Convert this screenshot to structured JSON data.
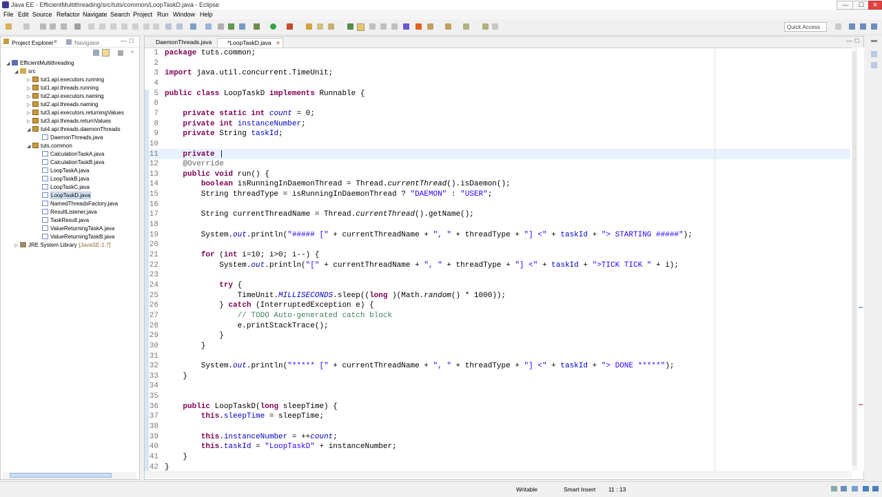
{
  "window": {
    "title": "Java EE - EfficientMultithreading/src/tuts/common/LoopTaskD.java - Eclipse",
    "controls": {
      "minimize": "—",
      "maximize": "☐",
      "close": "✕"
    }
  },
  "menu": [
    "File",
    "Edit",
    "Source",
    "Refactor",
    "Navigate",
    "Search",
    "Project",
    "Run",
    "Window",
    "Help"
  ],
  "toolbar": {
    "quick_access": "Quick Access"
  },
  "left_panel": {
    "tabs": [
      "Project Explorer",
      "Navigator"
    ],
    "tree": [
      {
        "label": "EfficientMultithreading",
        "level": 0,
        "icon": "project",
        "expanded": true
      },
      {
        "label": "src",
        "level": 1,
        "icon": "source-folder",
        "expanded": true
      },
      {
        "label": "tut1.api.executors.running",
        "level": 2,
        "icon": "package"
      },
      {
        "label": "tut1.api.threads.running",
        "level": 2,
        "icon": "package"
      },
      {
        "label": "tut2.api.executors.naming",
        "level": 2,
        "icon": "package"
      },
      {
        "label": "tut2.api.threads.naming",
        "level": 2,
        "icon": "package"
      },
      {
        "label": "tut3.api.executors.returningValues",
        "level": 2,
        "icon": "package"
      },
      {
        "label": "tut3.api.threads.returnValues",
        "level": 2,
        "icon": "package"
      },
      {
        "label": "tut4.api.threads.daemonThreads",
        "level": 2,
        "icon": "package",
        "expanded": true
      },
      {
        "label": "DaemonThreads.java",
        "level": 3,
        "icon": "java-file"
      },
      {
        "label": "tuts.common",
        "level": 2,
        "icon": "package",
        "expanded": true
      },
      {
        "label": "CalculationTaskA.java",
        "level": 3,
        "icon": "java-file"
      },
      {
        "label": "CalculationTaskB.java",
        "level": 3,
        "icon": "java-file"
      },
      {
        "label": "LoopTaskA.java",
        "level": 3,
        "icon": "java-file"
      },
      {
        "label": "LoopTaskB.java",
        "level": 3,
        "icon": "java-file"
      },
      {
        "label": "LoopTaskC.java",
        "level": 3,
        "icon": "java-file"
      },
      {
        "label": "LoopTaskD.java",
        "level": 3,
        "icon": "java-file",
        "selected": true
      },
      {
        "label": "NamedThreadsFactory.java",
        "level": 3,
        "icon": "java-file"
      },
      {
        "label": "ResultListener.java",
        "level": 3,
        "icon": "java-file"
      },
      {
        "label": "TaskResult.java",
        "level": 3,
        "icon": "java-file"
      },
      {
        "label": "ValueReturningTaskA.java",
        "level": 3,
        "icon": "java-file"
      },
      {
        "label": "ValueReturningTaskB.java",
        "level": 3,
        "icon": "java-file"
      },
      {
        "label": "JRE System Library",
        "suffix": "[JavaSE-1.7]",
        "level": 1,
        "icon": "library"
      }
    ]
  },
  "editor": {
    "tabs": [
      {
        "label": "DaemonThreads.java",
        "active": false
      },
      {
        "label": "*LoopTaskD.java",
        "active": true
      }
    ],
    "cursor_line": 11,
    "lines": [
      {
        "n": "1",
        "tokens": [
          [
            "kw",
            "package"
          ],
          [
            "",
            "tuts.common;"
          ]
        ]
      },
      {
        "n": "2",
        "tokens": []
      },
      {
        "n": "3",
        "tokens": [
          [
            "kw",
            "import"
          ],
          [
            "",
            "java.util.concurrent.TimeUnit;"
          ]
        ]
      },
      {
        "n": "4",
        "tokens": []
      },
      {
        "n": "5",
        "tokens": [
          [
            "kw",
            "public class"
          ],
          [
            "",
            " LoopTaskD "
          ],
          [
            "kw",
            "implements"
          ],
          [
            "",
            " Runnable {"
          ]
        ]
      },
      {
        "n": "6",
        "tokens": []
      },
      {
        "n": "7",
        "tokens": [
          [
            "",
            "    "
          ],
          [
            "kw",
            "private static int"
          ],
          [
            "",
            " "
          ],
          [
            "sfld",
            "count"
          ],
          [
            "",
            " = 0;"
          ]
        ]
      },
      {
        "n": "8",
        "tokens": [
          [
            "",
            "    "
          ],
          [
            "kw",
            "private int"
          ],
          [
            "",
            " "
          ],
          [
            "fld",
            "instanceNumber"
          ],
          [
            "",
            ";"
          ]
        ]
      },
      {
        "n": "9",
        "tokens": [
          [
            "",
            "    "
          ],
          [
            "kw",
            "private"
          ],
          [
            "",
            " String "
          ],
          [
            "fld",
            "taskId"
          ],
          [
            "",
            ";"
          ]
        ]
      },
      {
        "n": "10",
        "tokens": []
      },
      {
        "n": "11",
        "tokens": [
          [
            "",
            "    "
          ],
          [
            "kw",
            "private"
          ],
          [
            "",
            " |"
          ]
        ]
      },
      {
        "n": "12",
        "tokens": [
          [
            "",
            "    "
          ],
          [
            "ann",
            "@Override"
          ]
        ]
      },
      {
        "n": "13",
        "tokens": [
          [
            "",
            "    "
          ],
          [
            "kw",
            "public void"
          ],
          [
            "",
            " run() {"
          ]
        ]
      },
      {
        "n": "14",
        "tokens": [
          [
            "",
            "        "
          ],
          [
            "kw",
            "boolean"
          ],
          [
            "",
            " isRunningInDaemonThread = Thread."
          ],
          [
            "ital",
            "currentThread"
          ],
          [
            "",
            "().isDaemon();"
          ]
        ]
      },
      {
        "n": "15",
        "tokens": [
          [
            "",
            "        String threadType = isRunningInDaemonThread ? "
          ],
          [
            "str",
            "\"DAEMON\""
          ],
          [
            "",
            " : "
          ],
          [
            "str",
            "\"USER\""
          ],
          [
            "",
            ";"
          ]
        ]
      },
      {
        "n": "16",
        "tokens": []
      },
      {
        "n": "17",
        "tokens": [
          [
            "",
            "        String currentThreadName = Thread."
          ],
          [
            "ital",
            "currentThread"
          ],
          [
            "",
            "().getName();"
          ]
        ]
      },
      {
        "n": "18",
        "tokens": []
      },
      {
        "n": "19",
        "tokens": [
          [
            "",
            "        System."
          ],
          [
            "sfld",
            "out"
          ],
          [
            "",
            ".println("
          ],
          [
            "str",
            "\"##### [\""
          ],
          [
            "",
            " + currentThreadName + "
          ],
          [
            "str",
            "\", \""
          ],
          [
            "",
            " + threadType + "
          ],
          [
            "str",
            "\"] <\""
          ],
          [
            "",
            " + "
          ],
          [
            "fld",
            "taskId"
          ],
          [
            "",
            " + "
          ],
          [
            "str",
            "\"> STARTING #####\""
          ],
          [
            "",
            ");"
          ]
        ]
      },
      {
        "n": "20",
        "tokens": []
      },
      {
        "n": "21",
        "tokens": [
          [
            "",
            "        "
          ],
          [
            "kw",
            "for"
          ],
          [
            "",
            " ("
          ],
          [
            "kw",
            "int"
          ],
          [
            "",
            " i=10; i>0; i--) {"
          ]
        ]
      },
      {
        "n": "22",
        "tokens": [
          [
            "",
            "            System."
          ],
          [
            "sfld",
            "out"
          ],
          [
            "",
            ".println("
          ],
          [
            "str",
            "\"[\""
          ],
          [
            "",
            " + currentThreadName + "
          ],
          [
            "str",
            "\", \""
          ],
          [
            "",
            " + threadType + "
          ],
          [
            "str",
            "\"] <\""
          ],
          [
            "",
            " + "
          ],
          [
            "fld",
            "taskId"
          ],
          [
            "",
            " + "
          ],
          [
            "str",
            "\">TICK TICK \""
          ],
          [
            "",
            " + i);"
          ]
        ]
      },
      {
        "n": "23",
        "tokens": []
      },
      {
        "n": "24",
        "tokens": [
          [
            "",
            "            "
          ],
          [
            "kw",
            "try"
          ],
          [
            "",
            " {"
          ]
        ]
      },
      {
        "n": "25",
        "tokens": [
          [
            "",
            "                TimeUnit."
          ],
          [
            "sfld",
            "MILLISECONDS"
          ],
          [
            "",
            ".sleep(("
          ],
          [
            "kw",
            "long"
          ],
          [
            "",
            ")(Math."
          ],
          [
            "ital",
            "random"
          ],
          [
            "",
            "() * 1000));"
          ]
        ]
      },
      {
        "n": "26",
        "tokens": [
          [
            "",
            "            } "
          ],
          [
            "kw",
            "catch"
          ],
          [
            "",
            " (InterruptedException e) {"
          ]
        ]
      },
      {
        "n": "27",
        "tokens": [
          [
            "",
            "                "
          ],
          [
            "cmt",
            "// TODO Auto-generated catch block"
          ]
        ]
      },
      {
        "n": "28",
        "tokens": [
          [
            "",
            "                e.printStackTrace();"
          ]
        ]
      },
      {
        "n": "29",
        "tokens": [
          [
            "",
            "            }"
          ]
        ]
      },
      {
        "n": "30",
        "tokens": [
          [
            "",
            "        }"
          ]
        ]
      },
      {
        "n": "31",
        "tokens": []
      },
      {
        "n": "32",
        "tokens": [
          [
            "",
            "        System."
          ],
          [
            "sfld",
            "out"
          ],
          [
            "",
            ".println("
          ],
          [
            "str",
            "\"***** [\""
          ],
          [
            "",
            " + currentThreadName + "
          ],
          [
            "str",
            "\", \""
          ],
          [
            "",
            " + threadType + "
          ],
          [
            "str",
            "\"] <\""
          ],
          [
            "",
            " + "
          ],
          [
            "fld",
            "taskId"
          ],
          [
            "",
            " + "
          ],
          [
            "str",
            "\"> DONE *****\""
          ],
          [
            "",
            ");"
          ]
        ]
      },
      {
        "n": "33",
        "tokens": [
          [
            "",
            "    }"
          ]
        ]
      },
      {
        "n": "34",
        "tokens": []
      },
      {
        "n": "35",
        "tokens": []
      },
      {
        "n": "36",
        "tokens": [
          [
            "",
            "    "
          ],
          [
            "kw",
            "public"
          ],
          [
            "",
            " LoopTaskD("
          ],
          [
            "kw",
            "long"
          ],
          [
            "",
            " sleepTime) {"
          ]
        ]
      },
      {
        "n": "37",
        "tokens": [
          [
            "",
            "        "
          ],
          [
            "kw",
            "this"
          ],
          [
            "",
            "."
          ],
          [
            "fld",
            "sleepTime"
          ],
          [
            "",
            " = sleepTime;"
          ]
        ]
      },
      {
        "n": "38",
        "tokens": []
      },
      {
        "n": "39",
        "tokens": [
          [
            "",
            "        "
          ],
          [
            "kw",
            "this"
          ],
          [
            "",
            "."
          ],
          [
            "fld",
            "instanceNumber"
          ],
          [
            "",
            " = ++"
          ],
          [
            "sfld",
            "count"
          ],
          [
            "",
            ";"
          ]
        ]
      },
      {
        "n": "40",
        "tokens": [
          [
            "",
            "        "
          ],
          [
            "kw",
            "this"
          ],
          [
            "",
            "."
          ],
          [
            "fld",
            "taskId"
          ],
          [
            "",
            " = "
          ],
          [
            "str",
            "\"LoopTaskD\""
          ],
          [
            "",
            " + instanceNumber;"
          ]
        ]
      },
      {
        "n": "41",
        "tokens": [
          [
            "",
            "    }"
          ]
        ]
      },
      {
        "n": "42",
        "tokens": [
          [
            "",
            "}"
          ]
        ]
      }
    ]
  },
  "status": {
    "writable": "Writable",
    "insert_mode": "Smart Insert",
    "position": "11 : 13"
  },
  "colors": {
    "keyword": "#7f0055",
    "string": "#2a00ff",
    "field": "#0000c0",
    "comment": "#3f7f5f",
    "current_line": "#e8f2fe"
  }
}
